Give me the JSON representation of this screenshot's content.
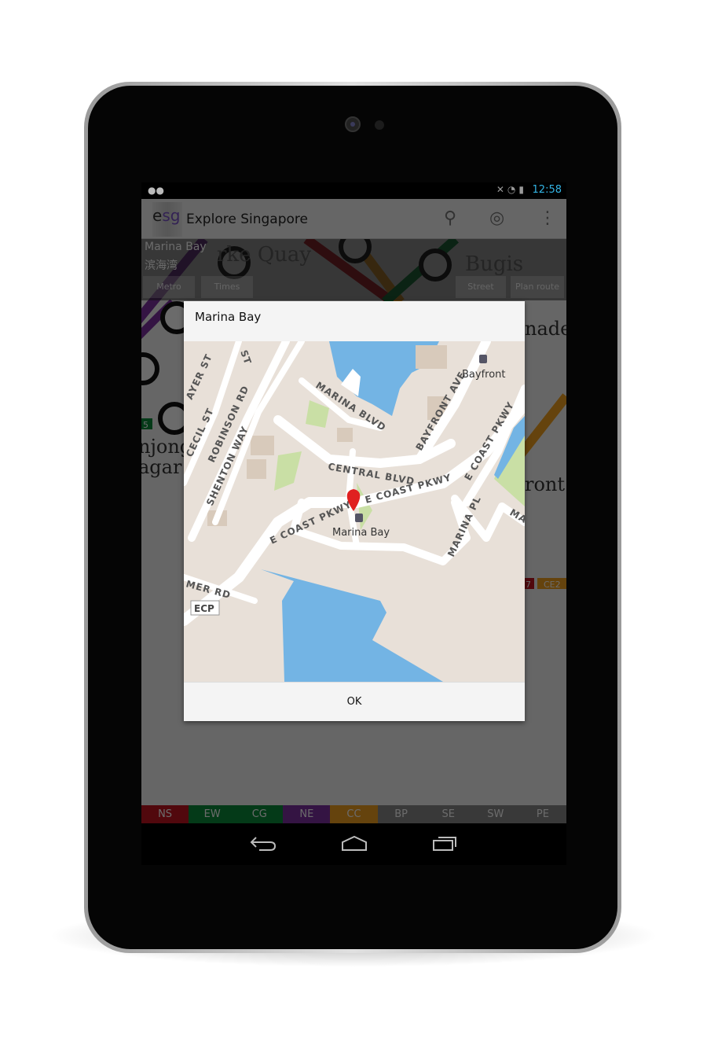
{
  "status_bar": {
    "time": "12:58",
    "icons": [
      "android-notification-icon",
      "mute-icon",
      "wifi-icon",
      "battery-charging-icon"
    ]
  },
  "action_bar": {
    "logo": "esg",
    "title": "Explore Singapore",
    "icons": [
      "search-icon",
      "locate-icon",
      "overflow-menu-icon"
    ]
  },
  "info": {
    "station_name": "Marina Bay",
    "station_name_cn": "滨海湾",
    "buttons": {
      "metro": "Metro",
      "times": "Times",
      "street": "Street",
      "plan_route": "Plan route"
    }
  },
  "metro_background": {
    "labels": [
      "rke Quay",
      "Bugis",
      "nade",
      "njong",
      "agar",
      "ront",
      "5",
      "7",
      "CE2"
    ]
  },
  "dialog": {
    "title": "Marina Bay",
    "ok_label": "OK",
    "map": {
      "streets": [
        "ST",
        "AYER ST",
        "CECIL ST",
        "ROBINSON RD",
        "SHENTON WAY",
        "MARINA BLVD",
        "CENTRAL BLVD",
        "BAYFRONT AVE",
        "E COAST PKWY",
        "E COAST PKWY",
        "E COAST PKWY",
        "MARINA PL",
        "MA",
        "MER RD"
      ],
      "stations": [
        "Bayfront",
        "Marina Bay"
      ],
      "highway_shield": "ECP",
      "marker_color": "#e02020",
      "water_color": "#73b4e4",
      "park_color": "#c9dfa5"
    }
  },
  "line_tabs": [
    {
      "label": "NS",
      "color": "#c0141e"
    },
    {
      "label": "EW",
      "color": "#0a8a3a"
    },
    {
      "label": "CG",
      "color": "#0a8a3a"
    },
    {
      "label": "NE",
      "color": "#7b2fa0"
    },
    {
      "label": "CC",
      "color": "#f0a020"
    },
    {
      "label": "BP",
      "color": "#888888"
    },
    {
      "label": "SE",
      "color": "#888888"
    },
    {
      "label": "SW",
      "color": "#888888"
    },
    {
      "label": "PE",
      "color": "#888888"
    }
  ],
  "nav_bar": {
    "icons": [
      "back-icon",
      "home-icon",
      "recent-apps-icon"
    ]
  }
}
